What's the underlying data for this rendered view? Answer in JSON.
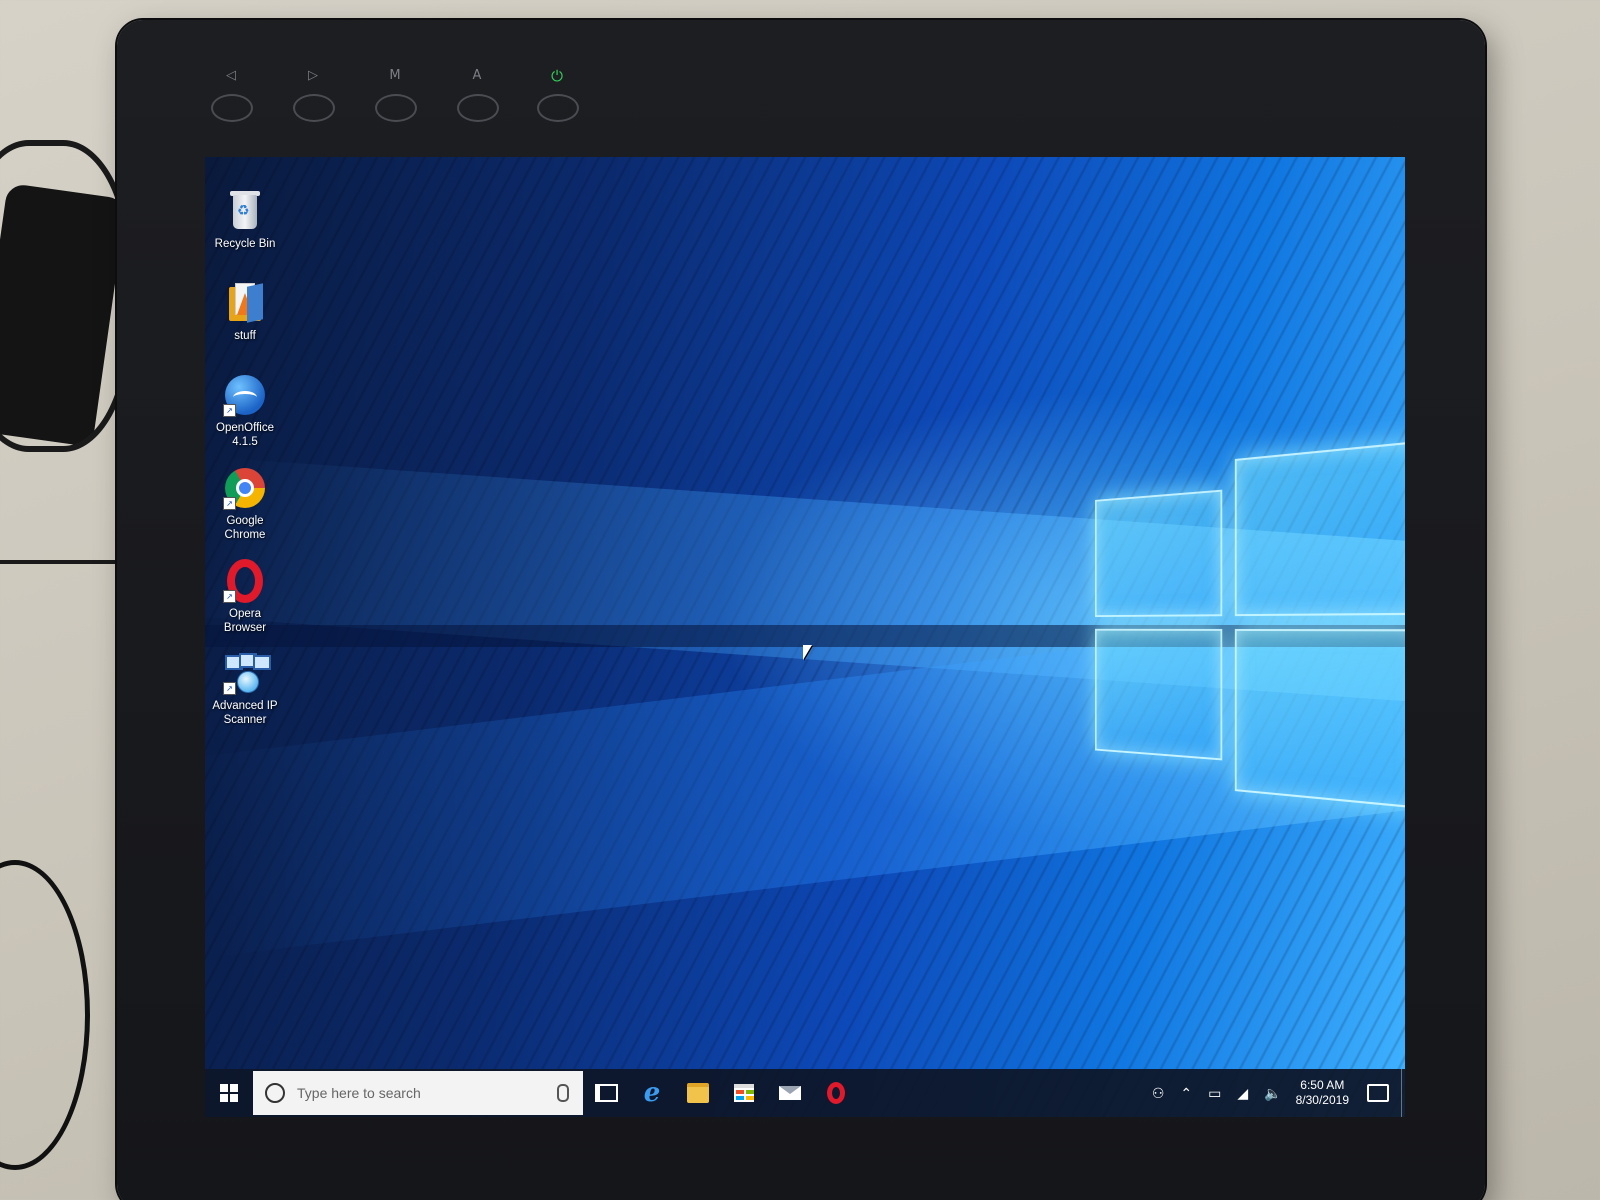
{
  "monitor": {
    "osd_buttons": [
      {
        "glyph": "◁",
        "name": "left"
      },
      {
        "glyph": "▷",
        "name": "right"
      },
      {
        "glyph": "M",
        "name": "menu"
      },
      {
        "glyph": "A",
        "name": "auto"
      },
      {
        "glyph": "⏻",
        "name": "power"
      }
    ],
    "power_led_color": "#34d05a"
  },
  "desktop": {
    "icons": [
      {
        "label": "Recycle Bin",
        "icon": "recycle-bin-icon"
      },
      {
        "label": "stuff",
        "icon": "folder-icon"
      },
      {
        "label": "OpenOffice\n4.1.5",
        "icon": "openoffice-icon"
      },
      {
        "label": "Google\nChrome",
        "icon": "chrome-icon"
      },
      {
        "label": "Opera\nBrowser",
        "icon": "opera-icon"
      },
      {
        "label": "Advanced IP\nScanner",
        "icon": "advanced-ip-scanner-icon"
      }
    ],
    "wallpaper_accent": "#1076e0"
  },
  "taskbar": {
    "search_placeholder": "Type here to search",
    "pinned": [
      "task-view",
      "edge",
      "file-explorer",
      "microsoft-store",
      "mail",
      "opera"
    ],
    "clock": {
      "time": "6:50 AM",
      "date": "8/30/2019"
    }
  }
}
